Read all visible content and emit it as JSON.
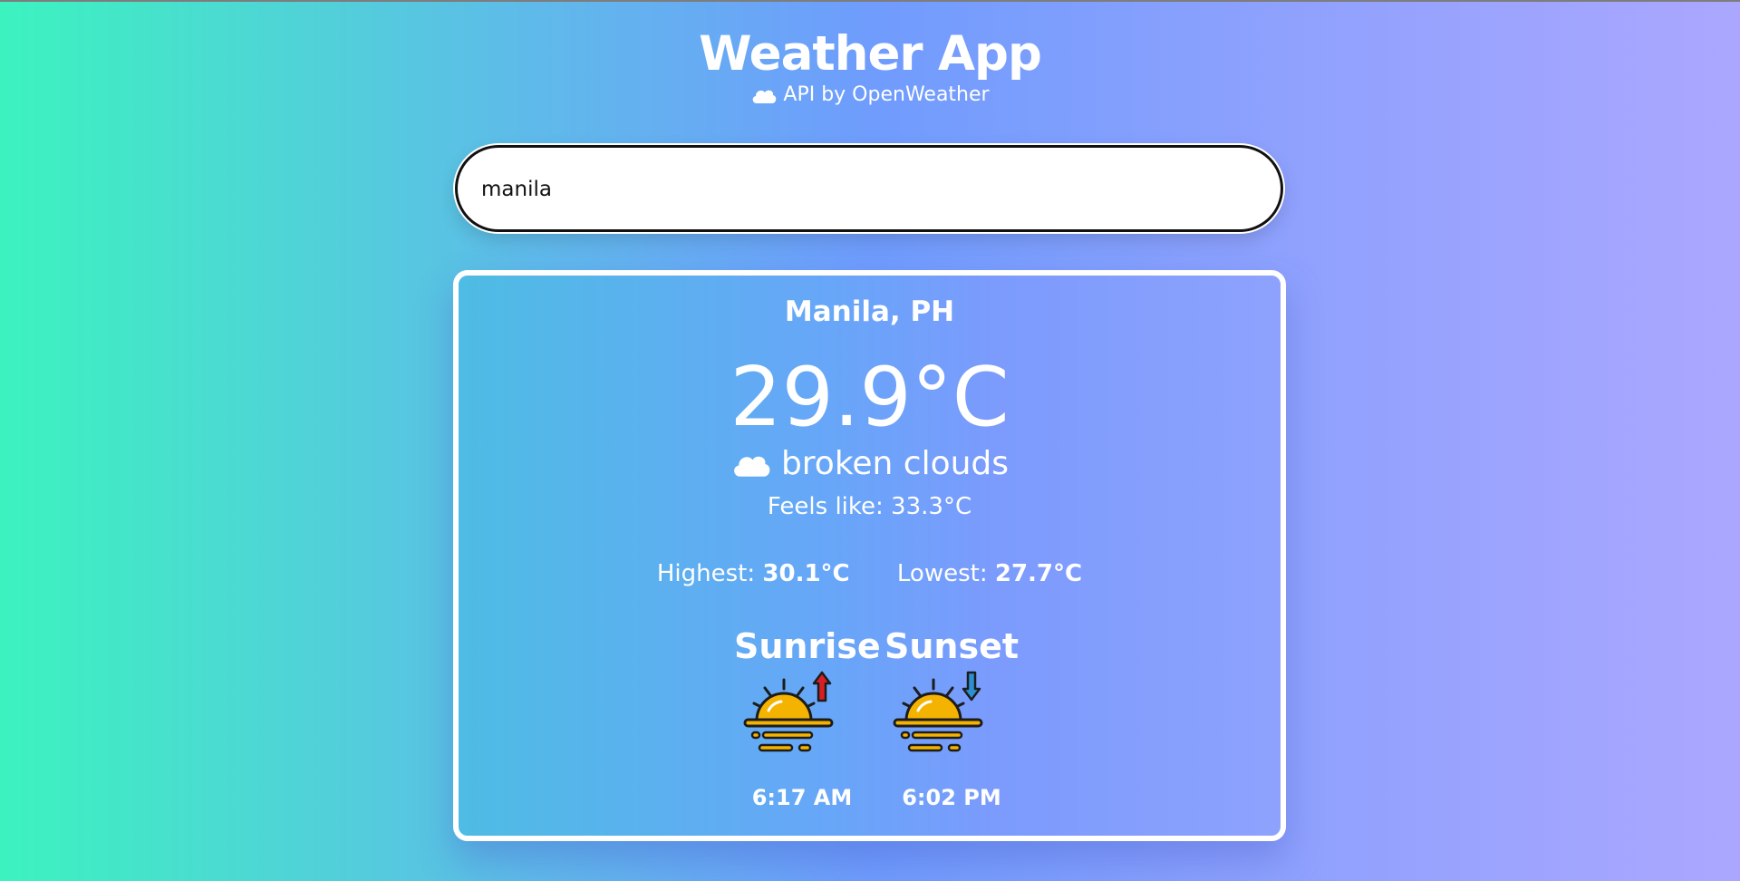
{
  "header": {
    "title": "Weather App",
    "subtitle": "API by OpenWeather",
    "subtitle_icon": "cloud-icon"
  },
  "search": {
    "value": "manila"
  },
  "weather": {
    "city": "Manila, PH",
    "temperature": "29.9°C",
    "description": "broken clouds",
    "description_icon": "cloud-icon",
    "feels_like": "Feels like: 33.3°C",
    "highest_label": "Highest:",
    "highest_value": "30.1°C",
    "lowest_label": "Lowest:",
    "lowest_value": "27.7°C"
  },
  "sun": {
    "sunrise_label": "Sunrise",
    "sunrise_time": "6:17 AM",
    "sunrise_icon": "sunrise-icon",
    "sunset_label": "Sunset",
    "sunset_time": "6:02 PM",
    "sunset_icon": "sunset-icon"
  },
  "colors": {
    "gradient_left": "#3cf3bf",
    "gradient_mid": "#6f9cfd",
    "gradient_right": "#aba7ff",
    "sun_fill": "#f5b301",
    "arrow_up": "#d81f26",
    "arrow_down": "#2b8fd1"
  }
}
